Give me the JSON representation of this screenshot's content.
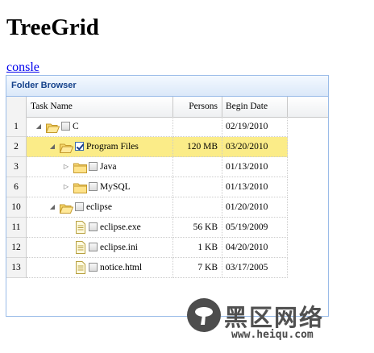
{
  "page": {
    "title": "TreeGrid",
    "console_link": "consle"
  },
  "panel": {
    "title": "Folder Browser"
  },
  "columns": {
    "task": "Task Name",
    "persons": "Persons",
    "begin": "Begin Date"
  },
  "rows": [
    {
      "num": "1",
      "name": "C",
      "persons": "",
      "date": "02/19/2010",
      "icon": "folder-open-icon",
      "arrow": "expanded",
      "checked": false,
      "selected": false
    },
    {
      "num": "2",
      "name": "Program Files",
      "persons": "120 MB",
      "date": "03/20/2010",
      "icon": "folder-open-icon",
      "arrow": "expanded",
      "checked": true,
      "selected": true
    },
    {
      "num": "3",
      "name": "Java",
      "persons": "",
      "date": "01/13/2010",
      "icon": "folder-icon",
      "arrow": "collapsed",
      "checked": false,
      "selected": false
    },
    {
      "num": "6",
      "name": "MySQL",
      "persons": "",
      "date": "01/13/2010",
      "icon": "folder-icon",
      "arrow": "collapsed",
      "checked": false,
      "selected": false
    },
    {
      "num": "10",
      "name": "eclipse",
      "persons": "",
      "date": "01/20/2010",
      "icon": "folder-open-icon",
      "arrow": "expanded",
      "checked": false,
      "selected": false
    },
    {
      "num": "11",
      "name": "eclipse.exe",
      "persons": "56 KB",
      "date": "05/19/2009",
      "icon": "file-icon",
      "arrow": "",
      "checked": false,
      "selected": false
    },
    {
      "num": "12",
      "name": "eclipse.ini",
      "persons": "1 KB",
      "date": "04/20/2010",
      "icon": "file-icon",
      "arrow": "",
      "checked": false,
      "selected": false
    },
    {
      "num": "13",
      "name": "notice.html",
      "persons": "7 KB",
      "date": "03/17/2005",
      "icon": "file-icon",
      "arrow": "",
      "checked": false,
      "selected": false
    }
  ],
  "watermark": {
    "brand": "黑区网络",
    "url": "www.heiqu.com"
  },
  "colors": {
    "selected_row": "#fbec88",
    "panel_border": "#99bbe8",
    "header_text": "#15428b",
    "link": "#0000ee"
  }
}
